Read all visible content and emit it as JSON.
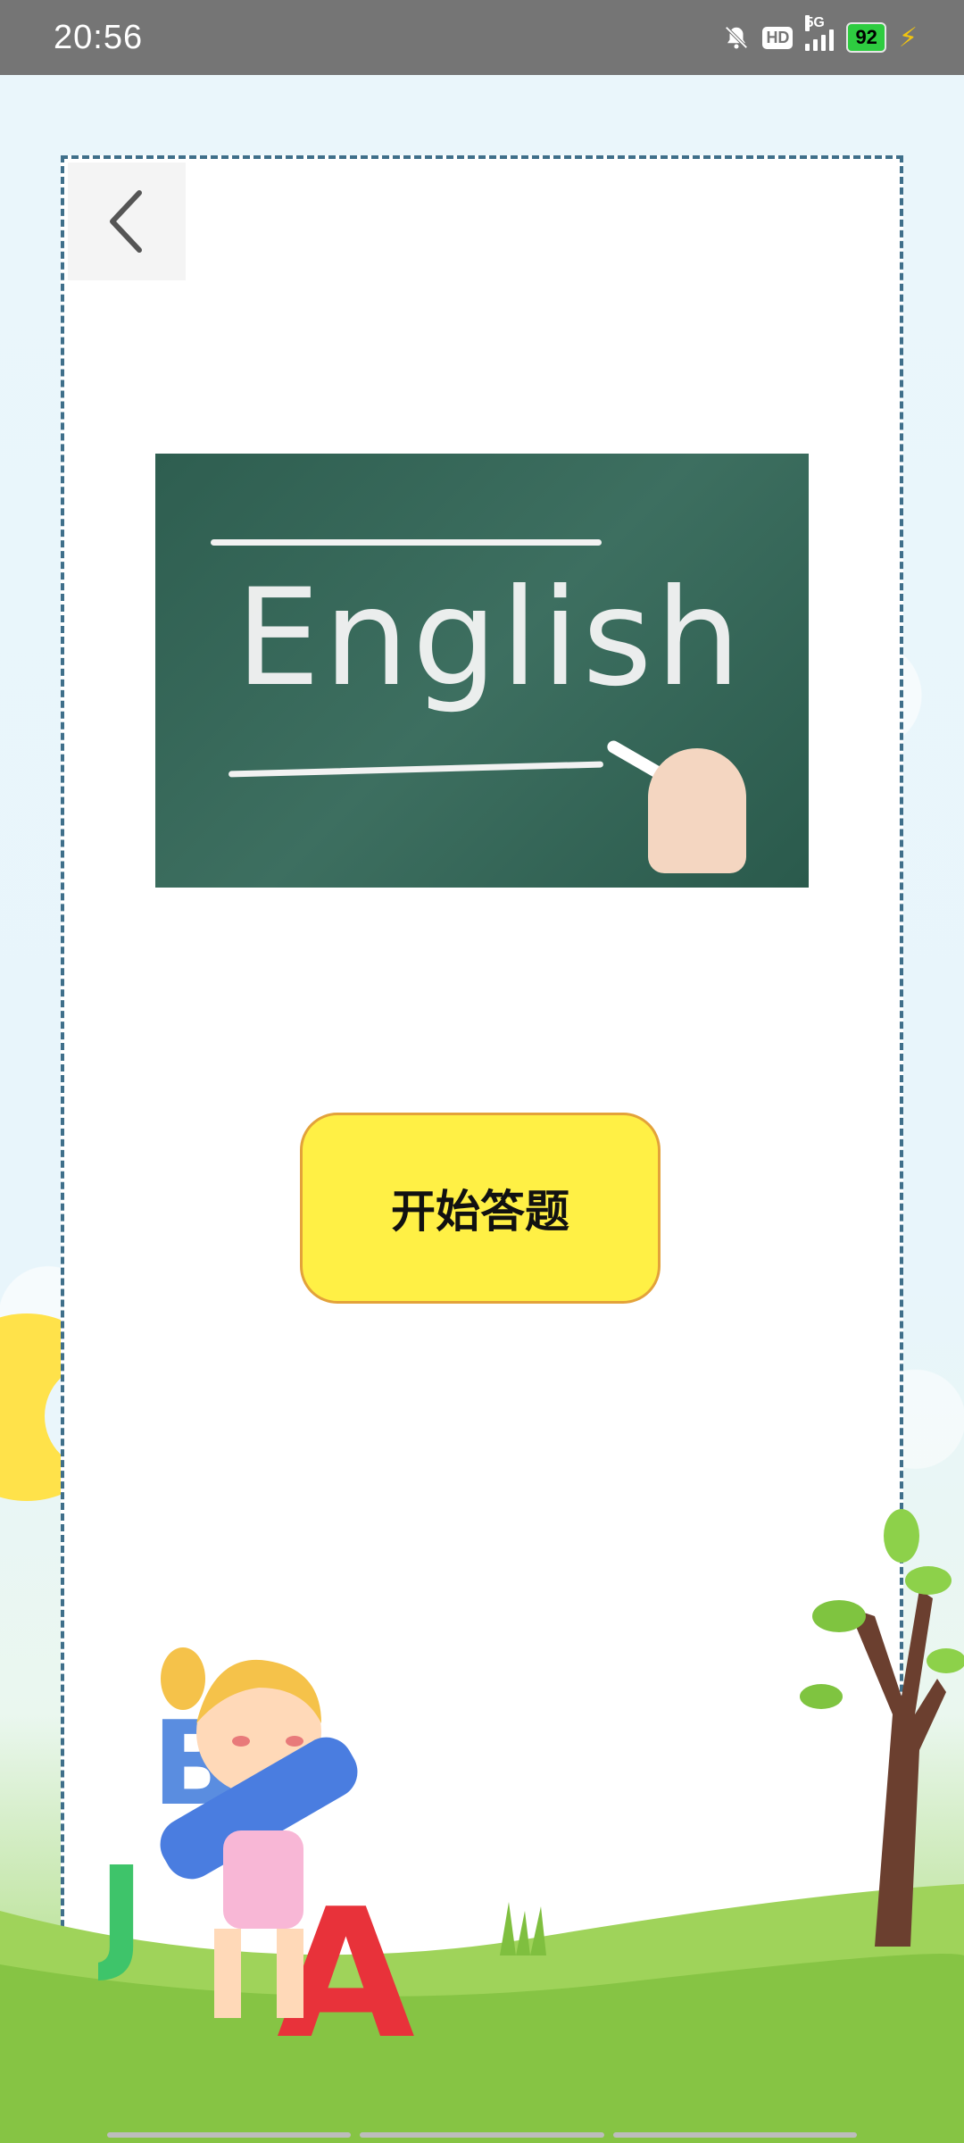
{
  "status_bar": {
    "time": "20:56",
    "network": "5G",
    "hd": "HD",
    "battery": "92",
    "icons": [
      "bell-off-icon",
      "hd-icon",
      "signal-icon",
      "battery-icon",
      "charging-icon"
    ]
  },
  "nav": {
    "back_icon": "chevron-left-icon"
  },
  "hero": {
    "text": "English"
  },
  "main": {
    "start_label": "开始答题"
  },
  "colors": {
    "button_bg": "#fff045",
    "button_border": "#e3a23a",
    "card_border": "#3f6f8a",
    "chalkboard": "#2e5e50"
  }
}
